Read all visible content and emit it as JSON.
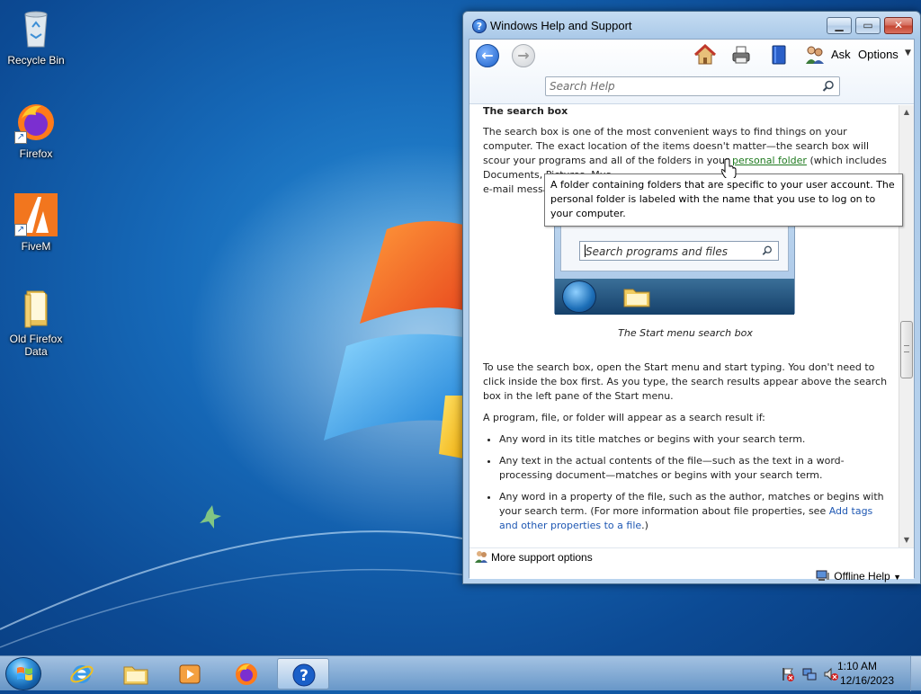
{
  "desktop": {
    "icons": [
      {
        "label": "Recycle Bin"
      },
      {
        "label": "Firefox"
      },
      {
        "label": "FiveM"
      },
      {
        "label": "Old Firefox Data"
      }
    ]
  },
  "window": {
    "title": "Windows Help and Support",
    "toolbar": {
      "ask_label": "Ask",
      "options_label": "Options"
    },
    "search": {
      "placeholder": "Search Help"
    },
    "article": {
      "section_title": "The search box",
      "para1_part1": "The search box is one of the most convenient ways to find things on your computer. The exact location of the items doesn't matter—the search box will scour your programs and all of the folders in your ",
      "para1_link": "personal folder",
      "para1_part2": " (which includes Documents, Pictures, Mus",
      "para1_line4": "e-mail messa",
      "screenshot_search_text": "Search programs and files",
      "caption": "The Start menu search box",
      "para2": "To use the search box, open the Start menu and start typing. You don't need to click inside the box first. As you type, the search results appear above the search box in the left pane of the Start menu.",
      "para3": "A program, file, or folder will appear as a search result if:",
      "bullets": [
        "Any word in its title matches or begins with your search term.",
        "Any text in the actual contents of the file—such as the text in a word-processing document—matches or begins with your search term."
      ],
      "bullet3_part1": "Any word in a property of the file, such as the author, matches or begins with your search term. (For more information about file properties, see ",
      "bullet3_link": "Add tags and other properties to a file",
      "bullet3_part2": ".)"
    },
    "tooltip": "A folder containing folders that are specific to your user account. The personal folder is labeled with the name that you use to log on to your computer.",
    "footer": {
      "more_support": "More support options",
      "offline_help": "Offline Help"
    }
  },
  "taskbar": {
    "clock_time": "1:10 AM",
    "clock_date": "12/16/2023"
  },
  "colors": {
    "link": "#1f58b3",
    "link_hover": "#1f7a1f"
  }
}
